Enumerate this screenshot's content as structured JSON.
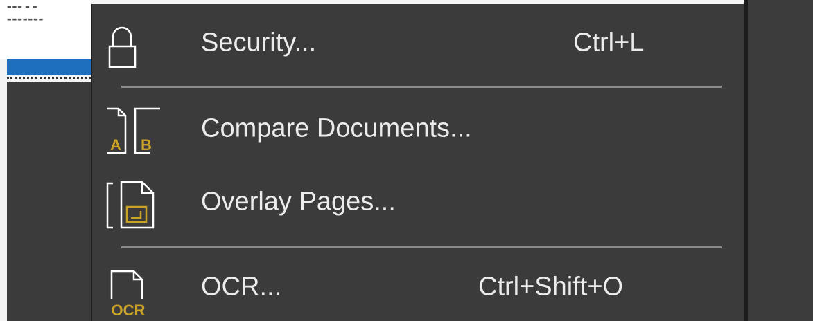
{
  "menu": {
    "items": [
      {
        "label": "Security...",
        "shortcut": "Ctrl+L",
        "icon": "lock-icon"
      },
      {
        "label": "Compare Documents...",
        "shortcut": "",
        "icon": "compare-documents-icon"
      },
      {
        "label": "Overlay Pages...",
        "shortcut": "",
        "icon": "overlay-pages-icon"
      },
      {
        "label": "OCR...",
        "shortcut": "Ctrl+Shift+O",
        "icon": "ocr-icon"
      }
    ],
    "icon_texts": {
      "compare_a": "A",
      "compare_b": "B",
      "ocr": "OCR"
    }
  },
  "colors": {
    "menu_background": "#3b3b3b",
    "menu_text": "#ececec",
    "separator": "#8a8a8a",
    "icon_stroke": "#ffffff",
    "icon_accent": "#c9a227",
    "selection_blue": "#1f6fbf"
  }
}
